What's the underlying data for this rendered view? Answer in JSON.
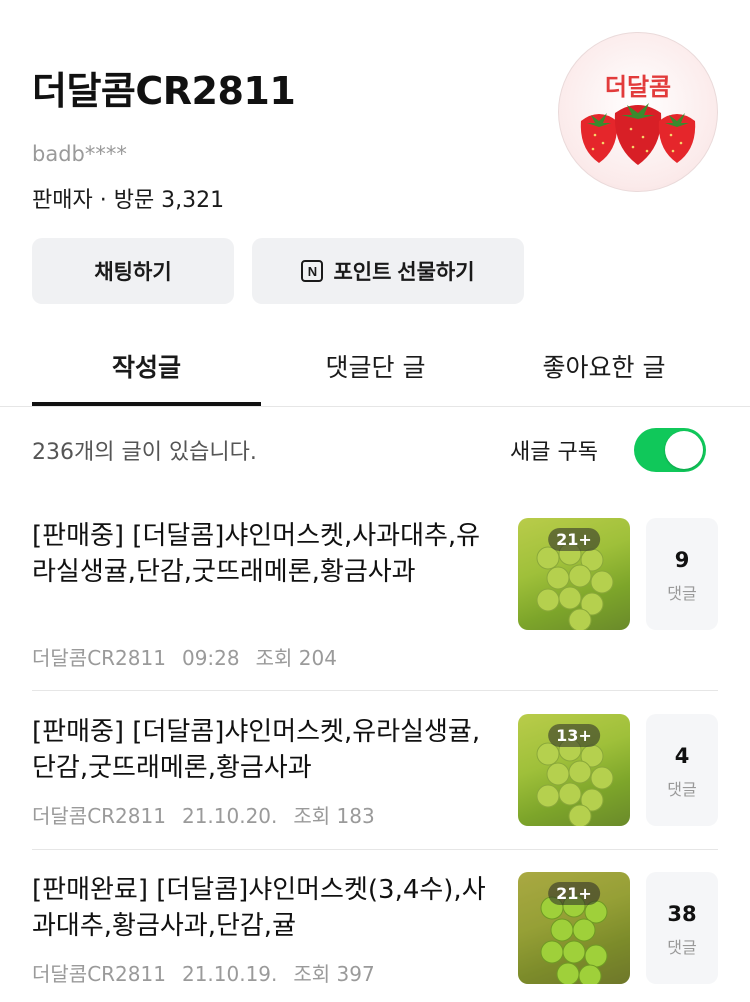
{
  "profile": {
    "shop_name": "더달콤CR2811",
    "user_id": "badb****",
    "meta": "판매자 · 방문 3,321",
    "avatar_logo": "더달콤"
  },
  "buttons": {
    "chat": "채팅하기",
    "point_icon": "N",
    "point": "포인트 선물하기"
  },
  "tabs": [
    "작성글",
    "댓글단 글",
    "좋아요한 글"
  ],
  "list_header": {
    "count": "236개의 글이 있습니다.",
    "subscribe_label": "새글 구독",
    "subscribe_on": true
  },
  "posts": [
    {
      "title": "[판매중] [더달콤]샤인머스켓,사과대추,유라실생귤,단감,굿뜨래메론,황금사과",
      "author": "더달콤CR2811",
      "date": "09:28",
      "views": "조회 204",
      "image_count": "21+",
      "comments": "9",
      "comment_label": "댓글"
    },
    {
      "title": "[판매중] [더달콤]샤인머스켓,유라실생귤,단감,굿뜨래메론,황금사과",
      "author": "더달콤CR2811",
      "date": "21.10.20.",
      "views": "조회 183",
      "image_count": "13+",
      "comments": "4",
      "comment_label": "댓글"
    },
    {
      "title": "[판매완료] [더달콤]샤인머스켓(3,4수),사과대추,황금사과,단감,귤",
      "author": "더달콤CR2811",
      "date": "21.10.19.",
      "views": "조회 397",
      "image_count": "21+",
      "comments": "38",
      "comment_label": "댓글"
    }
  ],
  "colors": {
    "toggle_on": "#10c85a",
    "logo_red": "#e23b3b"
  }
}
